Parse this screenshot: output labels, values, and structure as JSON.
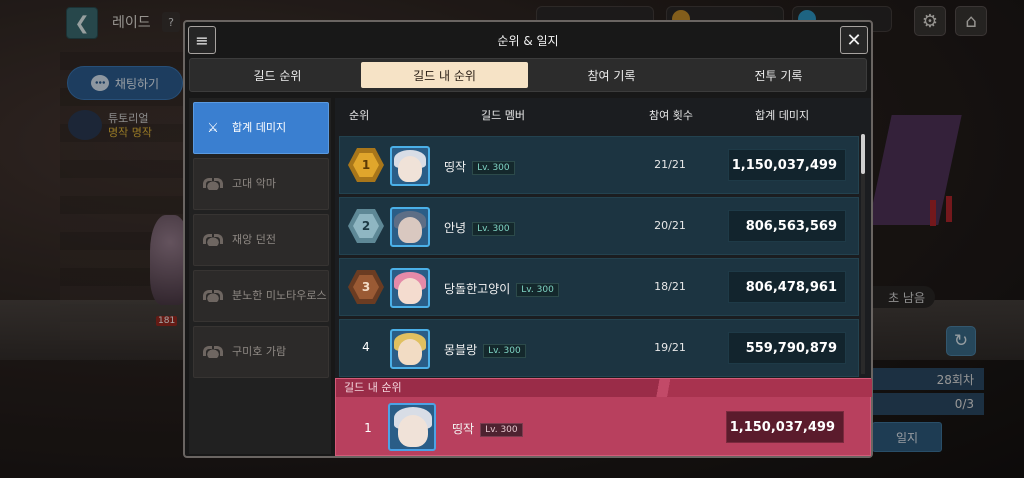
{
  "hud": {
    "title": "레이드",
    "help": "?",
    "chat_label": "채팅하기",
    "tutorial_line1": "튜토리얼",
    "tutorial_line2": "명작 명작",
    "monster_hp": "181"
  },
  "side": {
    "remain": "초 남음",
    "count": "28회차",
    "progress": "0/3",
    "button": "일지"
  },
  "modal": {
    "title": "순위 & 일지",
    "menu_icon": "≡",
    "close_icon": "✕",
    "tabs": [
      {
        "label": "길드 순위",
        "active": false
      },
      {
        "label": "길드 내 순위",
        "active": true
      },
      {
        "label": "참여 기록",
        "active": false
      },
      {
        "label": "전투 기록",
        "active": false
      }
    ],
    "categories": [
      {
        "label": "합계 데미지",
        "icon": "crossed-swords-icon",
        "active": true
      },
      {
        "label": "고대 악마",
        "icon": "horn-icon",
        "active": false
      },
      {
        "label": "재앙 던전",
        "icon": "horn-icon",
        "active": false
      },
      {
        "label": "분노한 미노타우로스",
        "icon": "horn-icon",
        "active": false
      },
      {
        "label": "구미호 가람",
        "icon": "horn-icon",
        "active": false
      }
    ],
    "table": {
      "headers": {
        "rank": "순위",
        "member": "길드 멤버",
        "count": "참여 횟수",
        "damage": "합계 데미지"
      },
      "rows": [
        {
          "rank": "1",
          "name": "띵작",
          "level": "Lv. 300",
          "count": "21/21",
          "damage": "1,150,037,499"
        },
        {
          "rank": "2",
          "name": "안녕",
          "level": "Lv. 300",
          "count": "20/21",
          "damage": "806,563,569"
        },
        {
          "rank": "3",
          "name": "당돌한고양이",
          "level": "Lv. 300",
          "count": "18/21",
          "damage": "806,478,961"
        },
        {
          "rank": "4",
          "name": "몽블랑",
          "level": "Lv. 300",
          "count": "19/21",
          "damage": "559,790,879"
        }
      ]
    },
    "mine": {
      "header": "길드 내 순위",
      "rank": "1",
      "name": "띵작",
      "level": "Lv. 300",
      "damage": "1,150,037,499"
    }
  },
  "colors": {
    "gold_hex": "#e0a62c",
    "silver_hex": "#8fb6c2",
    "bronze_hex": "#9a5a34",
    "active_category": "#3a7fd0",
    "mine_bg": "#b8405e"
  }
}
